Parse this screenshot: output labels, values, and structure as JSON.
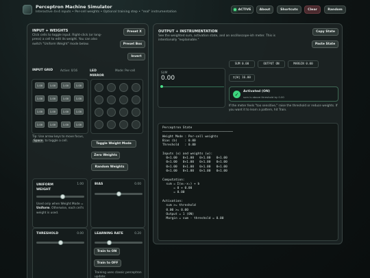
{
  "header": {
    "title": "Perceptron Machine Simulator",
    "subtitle": "Interactive 4×4 inputs • Per-cell weights • Optional training step • \"real\" instrumentation",
    "status": "ACTIVE",
    "buttons": {
      "about": "About",
      "shortcuts": "Shortcuts",
      "clear": "Clear",
      "random": "Random"
    }
  },
  "input_panel": {
    "title": "INPUT + WEIGHTS",
    "desc": "Click cells to toggle input. Right-click (or long-press) a cell to edit its weight. You can also switch \"Uniform Weight\" mode below.",
    "buttons": {
      "preset_x": "Preset X",
      "preset_box": "Preset Box",
      "invert": "Invert"
    },
    "grid_title": "INPUT GRID",
    "active_count": "Active: 0/16",
    "mirror_title": "LED MIRROR",
    "mode": "Mode: Per-cell",
    "cells": [
      "1.00",
      "1.00",
      "1.00",
      "1.00",
      "1.00",
      "1.00",
      "1.00",
      "1.00",
      "1.00",
      "1.00",
      "1.00",
      "1.00",
      "1.00",
      "1.00",
      "1.00",
      "1.00"
    ],
    "tip_pre": "Tip: Use arrow keys to move focus,",
    "tip_key": "Space",
    "tip_post": "to toggle a cell.",
    "mode_buttons": {
      "toggle": "Toggle Weight Mode",
      "zero": "Zero Weights",
      "random": "Random Weights"
    },
    "uniform": {
      "label": "UNIFORM WEIGHT",
      "value": "1.00",
      "level": 0.55,
      "note_pre": "Used only when Weight Mode =",
      "note_bold": "Uniform",
      "note_post": ". Otherwise, each cell's weight is used."
    },
    "bias": {
      "label": "BIAS",
      "value": "0.00",
      "level": 0.5
    },
    "threshold": {
      "label": "THRESHOLD",
      "value": "0.00",
      "level": 0.5
    },
    "learning": {
      "label": "LEARNING RATE",
      "value": "0.20",
      "level": 0.3,
      "train_on": "Train to ON",
      "train_off": "Train to OFF",
      "note": "Training uses classic perceptron update:"
    }
  },
  "output_panel": {
    "title": "OUTPUT + INSTRUMENTATION",
    "desc": "See the weighted sum, activation state, and an oscilloscope-ish meter. This is intentionally \"explainable.\"",
    "buttons": {
      "copy": "Copy State",
      "paste": "Paste State"
    },
    "meter": {
      "label": "SUM",
      "value": "0.00"
    },
    "chips": {
      "sum": "SUM  0.00",
      "output": "OUTPUT  ON",
      "margin": "MARGIN  0.00",
      "abs_w": "Σ|W|  16.00"
    },
    "activation": {
      "title": "Activated (ON)",
      "detail": "sum is above threshold by 0.00"
    },
    "hint": "If the meter feels \"too sensitive,\" raise the threshold or reduce weights. If you want it to learn a pattern, hit Train.",
    "state_lines": [
      "Perceptron State",
      "──────────────────────────────────────",
      "Weight Mode : Per-cell weights",
      "Bias (b)    : 0.00",
      "Threshold   : 0.00",
      "",
      "Inputs (x) and weights (w):",
      "  0×1.00   0×1.00   0×1.00   0×1.00",
      "  0×1.00   0×1.00   0×1.00   0×1.00",
      "  0×1.00   0×1.00   0×1.00   0×1.00",
      "  0×1.00   0×1.00   0×1.00   0×1.00",
      "",
      "Computation:",
      "  sum = Σ(wᵢ·xᵢ) + b",
      "      = 0 + 0.00",
      "      = 0.00",
      "",
      "Activation:",
      "  sum >= threshold",
      "  0.00 >= 0.00",
      "  Output = 1 (ON)",
      "  Margin = sum - threshold = 0.00"
    ]
  },
  "colors": {
    "accent_green": "#4ce08a",
    "clear_button": "#4a2a2e"
  }
}
